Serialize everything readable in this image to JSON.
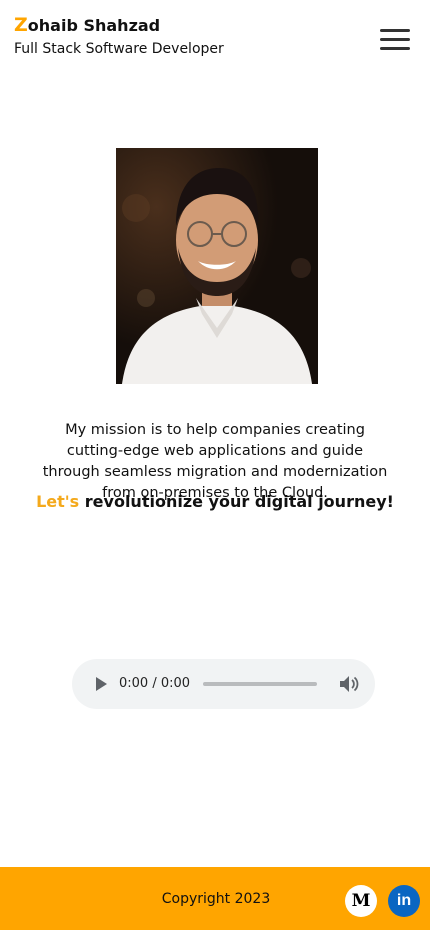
{
  "header": {
    "brand_initial": "Z",
    "brand_rest": "ohaib Shahzad",
    "role": "Full Stack Software Developer",
    "menu_icon": "hamburger-menu-icon"
  },
  "profile": {
    "photo_icon": "profile-photo"
  },
  "mission": {
    "text": "My mission is to help companies creating cutting-edge web applications and guide  through seamless migration and modernization from on-premises to the Cloud.",
    "tagline_accent": "Let's",
    "tagline_rest": " revolutionize your digital journey!"
  },
  "audio": {
    "time": "0:00 / 0:00",
    "progress": 0,
    "play_icon": "play-icon",
    "volume_icon": "volume-icon"
  },
  "footer": {
    "copyright": "Copyright 2023",
    "medium_label": "M",
    "linkedin_label": "in"
  },
  "colors": {
    "accent": "#ffa500",
    "linkedin": "#0a66c2",
    "player_bg": "#f1f3f4"
  }
}
